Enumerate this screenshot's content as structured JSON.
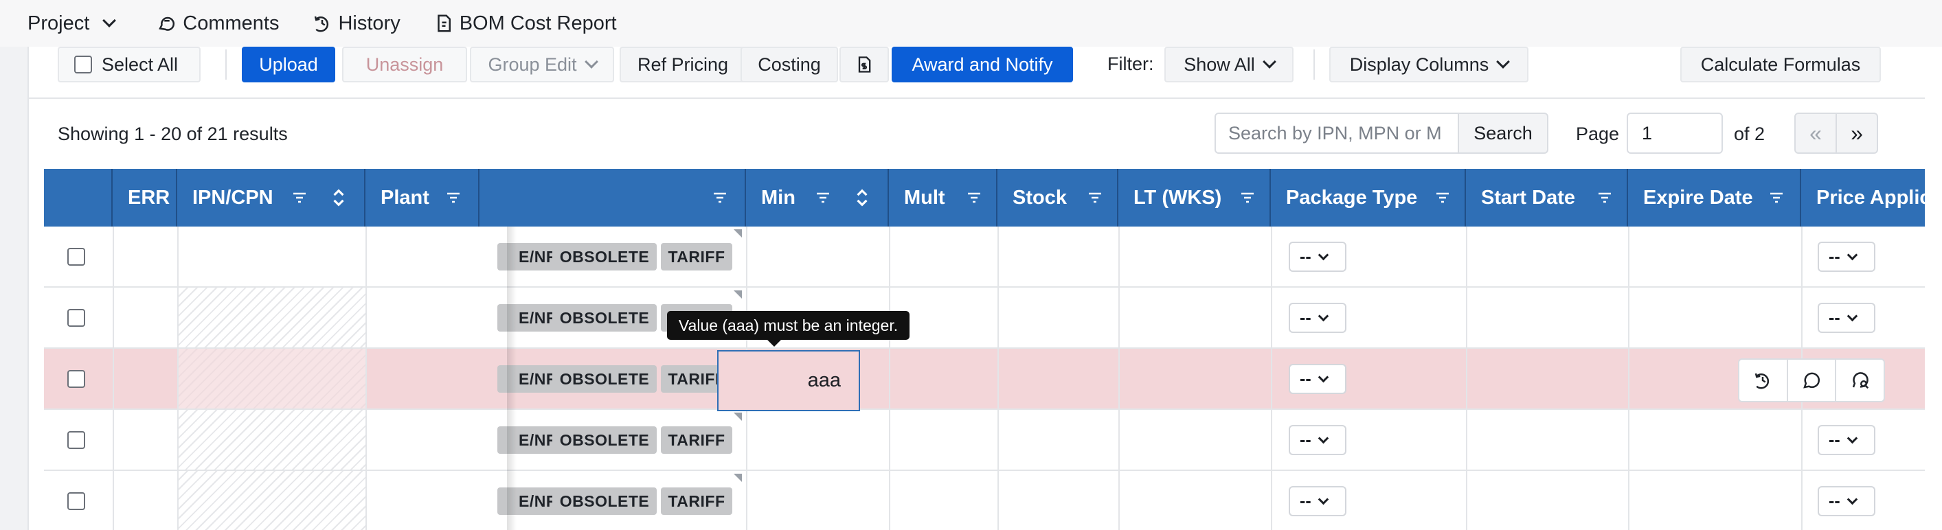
{
  "nav": {
    "project": "Project",
    "comments": "Comments",
    "history": "History",
    "bom_cost_report": "BOM Cost Report"
  },
  "toolbar": {
    "select_all": "Select All",
    "upload": "Upload",
    "unassign": "Unassign",
    "group_edit": "Group Edit",
    "ref_pricing": "Ref Pricing",
    "costing": "Costing",
    "award_notify": "Award and Notify",
    "filter_label": "Filter:",
    "filter_value": "Show All",
    "display_columns": "Display Columns",
    "calculate_formulas": "Calculate Formulas"
  },
  "results": {
    "showing": "Showing 1 - 20 of 21 results",
    "search_placeholder": "Search by IPN, MPN or M",
    "search_button": "Search",
    "page_label": "Page",
    "page_value": "1",
    "page_of": "of 2",
    "first": "«",
    "next": "»"
  },
  "columns": {
    "err": "ERR",
    "ipn": "IPN/CPN",
    "plant": "Plant",
    "min": "Min",
    "mult": "Mult",
    "stock": "Stock",
    "lt": "LT (WKS)",
    "package_type": "Package Type",
    "start_date": "Start Date",
    "expire_date": "Expire Date",
    "price_applic": "Price Applic"
  },
  "tags": {
    "nr": "E/NR",
    "obsolete": "OBSOLETE",
    "tariff": "TARIFF"
  },
  "rows": [
    {
      "package": "--",
      "price": "--"
    },
    {
      "package": "--",
      "price": "--"
    },
    {
      "package": "--",
      "price": "--"
    },
    {
      "package": "--",
      "price": "--"
    },
    {
      "package": "--",
      "price": "--"
    }
  ],
  "edit": {
    "value": "aaa",
    "error": "Value (aaa) must be an integer."
  },
  "colors": {
    "header_blue": "#2f6fb6",
    "primary": "#0b5ed7",
    "error_row": "#f3d6d9"
  }
}
